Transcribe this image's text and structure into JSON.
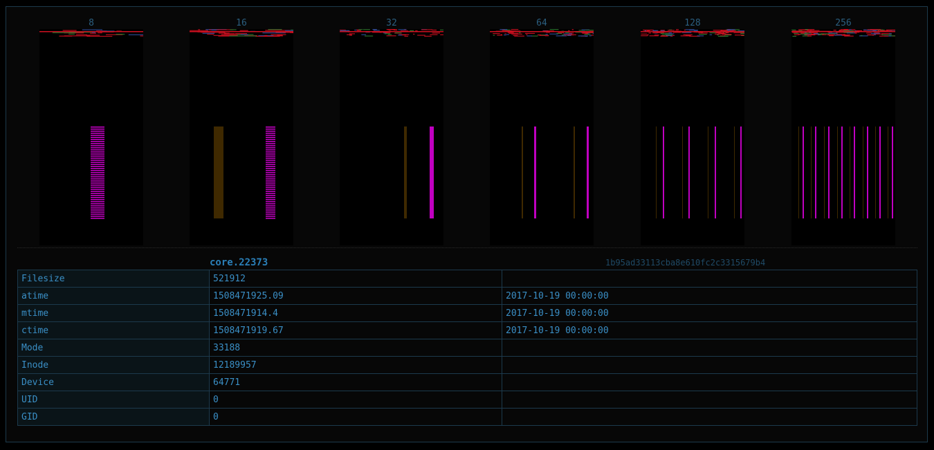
{
  "visualizations": [
    {
      "label": "8"
    },
    {
      "label": "16"
    },
    {
      "label": "32"
    },
    {
      "label": "64"
    },
    {
      "label": "128"
    },
    {
      "label": "256"
    }
  ],
  "file": {
    "name": "core.22373",
    "hash": "1b95ad33113cba8e610fc2c3315679b4"
  },
  "metadata": [
    {
      "key": "Filesize",
      "value": "521912",
      "date": ""
    },
    {
      "key": "atime",
      "value": "1508471925.09",
      "date": "2017-10-19 00:00:00"
    },
    {
      "key": "mtime",
      "value": "1508471914.4",
      "date": "2017-10-19 00:00:00"
    },
    {
      "key": "ctime",
      "value": "1508471919.67",
      "date": "2017-10-19 00:00:00"
    },
    {
      "key": "Mode",
      "value": "33188",
      "date": ""
    },
    {
      "key": "Inode",
      "value": "12189957",
      "date": ""
    },
    {
      "key": "Device",
      "value": "64771",
      "date": ""
    },
    {
      "key": "UID",
      "value": "0",
      "date": ""
    },
    {
      "key": "GID",
      "value": "0",
      "date": ""
    }
  ],
  "colors": {
    "accent": "#3a8fc6",
    "magenta": "#c000c0",
    "red": "#d01020",
    "amber": "#5a3a00"
  }
}
